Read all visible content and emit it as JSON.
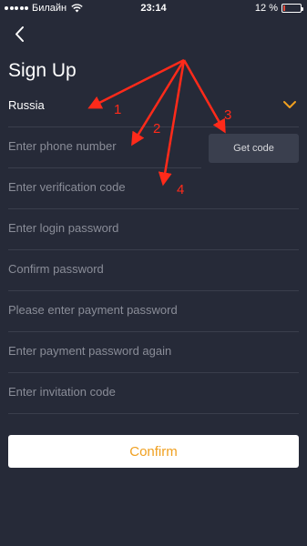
{
  "status_bar": {
    "carrier": "Билайн",
    "time": "23:14",
    "battery_text": "12 %",
    "battery_level": 0.12
  },
  "header": {
    "title": "Sign Up",
    "back_icon": "chevron-left-icon"
  },
  "form": {
    "country": "Russia",
    "phone_placeholder": "Enter phone number",
    "get_code_label": "Get code",
    "verification_placeholder": "Enter verification code",
    "login_password_placeholder": "Enter login password",
    "confirm_password_placeholder": "Confirm password",
    "payment_password_placeholder": "Please enter payment password",
    "payment_password_again_placeholder": "Enter payment password again",
    "invitation_placeholder": "Enter invitation code",
    "confirm_label": "Confirm"
  },
  "annotations": {
    "labels": [
      "1",
      "2",
      "3",
      "4"
    ],
    "color": "#ff2a1a"
  },
  "colors": {
    "background": "#262a38",
    "accent": "#f0a020",
    "divider": "#3a3e4c"
  }
}
